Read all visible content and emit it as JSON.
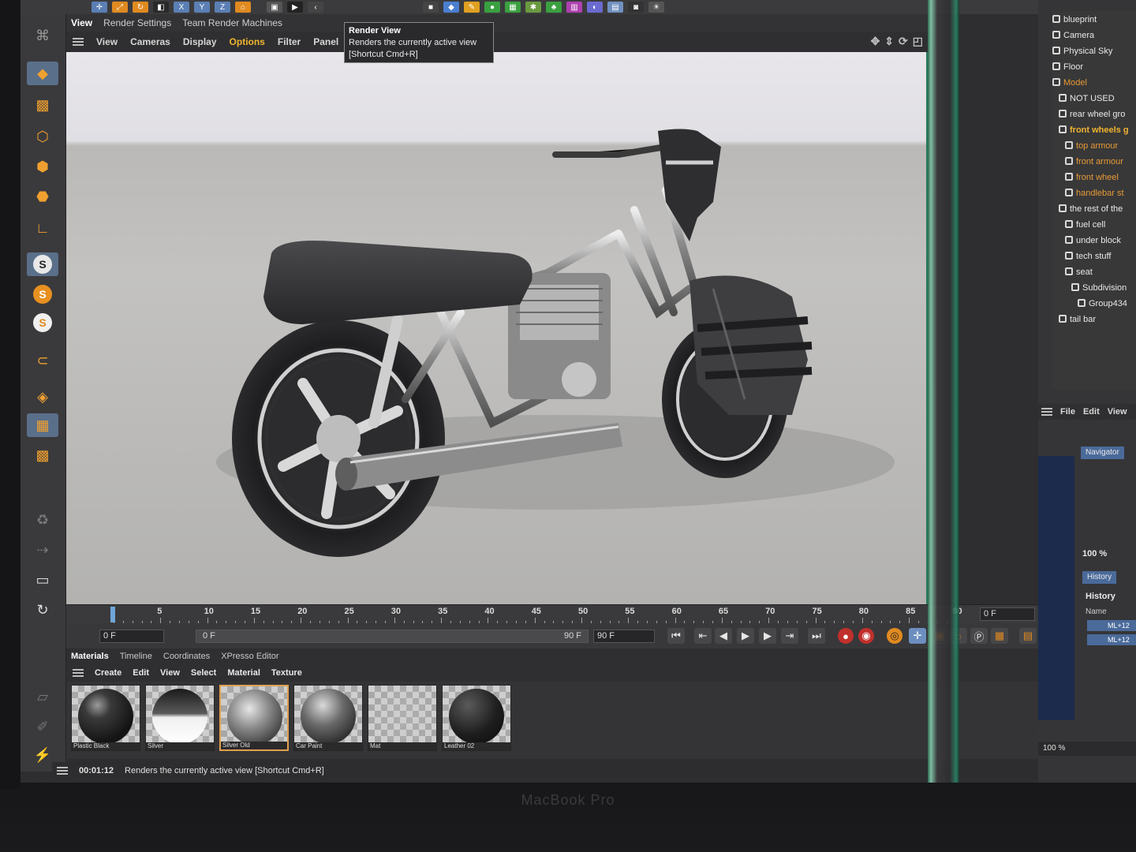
{
  "tabs": {
    "view": "View",
    "render_settings": "Render Settings",
    "team_render": "Team Render Machines"
  },
  "viewport_menu": {
    "items": [
      "View",
      "Cameras",
      "Display",
      "Options",
      "Filter",
      "Panel",
      "Pro"
    ],
    "active": "Options"
  },
  "tooltip": {
    "title": "Render View",
    "line1": "Renders the currently active view",
    "line2": "[Shortcut Cmd+R]"
  },
  "timeline": {
    "ticks": [
      "0",
      "5",
      "10",
      "15",
      "20",
      "25",
      "30",
      "35",
      "40",
      "45",
      "50",
      "55",
      "60",
      "65",
      "70",
      "75",
      "80",
      "85",
      "90"
    ],
    "current_frame": "0 F"
  },
  "transport": {
    "start_frame": "0 F",
    "range_start": "0 F",
    "range_end": "90 F",
    "end_frame": "90 F"
  },
  "materials": {
    "tabs": [
      "Materials",
      "Timeline",
      "Coordinates",
      "XPresso Editor"
    ],
    "menu": [
      "Create",
      "Edit",
      "View",
      "Select",
      "Material",
      "Texture"
    ],
    "swatches": [
      {
        "label": "Plastic Black",
        "type": "dark"
      },
      {
        "label": "Silver",
        "type": "chrome"
      },
      {
        "label": "Silver Old",
        "type": "old"
      },
      {
        "label": "Car Paint",
        "type": "metal"
      },
      {
        "label": "Mat",
        "type": "empty"
      },
      {
        "label": "Leather 02",
        "type": "leather"
      }
    ]
  },
  "status": {
    "time": "00:01:12",
    "message": "Renders the currently active view [Shortcut Cmd+R]"
  },
  "object_tree": [
    {
      "label": "blueprint",
      "indent": 0,
      "state": "normal"
    },
    {
      "label": "Camera",
      "indent": 0,
      "state": "normal"
    },
    {
      "label": "Physical Sky",
      "indent": 0,
      "state": "normal"
    },
    {
      "label": "Floor",
      "indent": 0,
      "state": "normal"
    },
    {
      "label": "Model",
      "indent": 0,
      "state": "hl2"
    },
    {
      "label": "NOT USED",
      "indent": 1,
      "state": "normal"
    },
    {
      "label": "rear wheel gro",
      "indent": 1,
      "state": "normal"
    },
    {
      "label": "front wheels g",
      "indent": 1,
      "state": "hl"
    },
    {
      "label": "top armour",
      "indent": 2,
      "state": "hl2"
    },
    {
      "label": "front armour",
      "indent": 2,
      "state": "hl2"
    },
    {
      "label": "front wheel",
      "indent": 2,
      "state": "hl2"
    },
    {
      "label": "handlebar st",
      "indent": 2,
      "state": "hl2"
    },
    {
      "label": "the rest of the",
      "indent": 1,
      "state": "normal"
    },
    {
      "label": "fuel cell",
      "indent": 2,
      "state": "normal"
    },
    {
      "label": "under block",
      "indent": 2,
      "state": "normal"
    },
    {
      "label": "tech stuff",
      "indent": 2,
      "state": "normal"
    },
    {
      "label": "seat",
      "indent": 2,
      "state": "normal"
    },
    {
      "label": "Subdivision",
      "indent": 3,
      "state": "normal"
    },
    {
      "label": "Group434",
      "indent": 4,
      "state": "normal"
    },
    {
      "label": "tail bar",
      "indent": 1,
      "state": "normal"
    }
  ],
  "right_panel": {
    "menu": [
      "File",
      "Edit",
      "View"
    ],
    "navigator_tab": "Navigator",
    "zoom": "100 %",
    "history_tab": "History",
    "history_title": "History",
    "history_col": "Name",
    "history_items": [
      "ML+12",
      "ML+12"
    ],
    "bottom_zoom": "100 %"
  },
  "brand": "MacBook Pro"
}
